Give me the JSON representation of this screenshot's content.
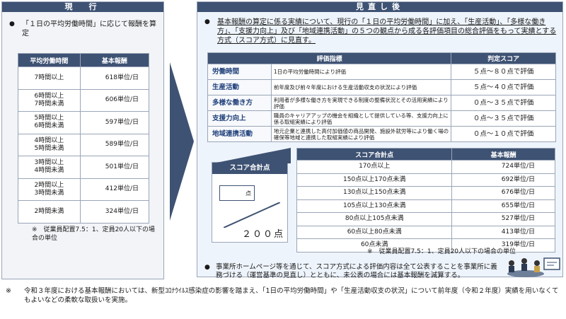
{
  "left": {
    "title": "現　行",
    "description": "「１日の平均労働時間」に応じて報酬を算定",
    "table": {
      "headers": [
        "平均労働時間",
        "基本報酬"
      ],
      "rows": [
        {
          "hours": "7時間以上",
          "fee": "618単位/日"
        },
        {
          "hours": "6時間以上\n7時間未満",
          "fee": "606単位/日"
        },
        {
          "hours": "5時間以上\n6時間未満",
          "fee": "597単位/日"
        },
        {
          "hours": "4時間以上\n5時間未満",
          "fee": "589単位/日"
        },
        {
          "hours": "3時間以上\n4時間未満",
          "fee": "501単位/日"
        },
        {
          "hours": "2時間以上\n3時間未満",
          "fee": "412単位/日"
        },
        {
          "hours": "2時間未満",
          "fee": "324単位/日"
        }
      ]
    },
    "note": "※　従業員配置7.5：1、定員20人以下の場合の単位"
  },
  "right": {
    "title": "見直し後",
    "description_main": "基本報酬の算定に係る実績について、現行の「１日の平均労働時間」に加え、「生産活動」、「多様な働き方」、「支援力向上」及び「地域連携活動」の５つの観点から成る各評価項目の総合評価をもって実績とする方式（スコア方式）に見直す。",
    "eval_table": {
      "headers": [
        "評価指標",
        "判定スコア"
      ],
      "rows": [
        {
          "name": "労働時間",
          "desc": "1日の平均労働時間により評価",
          "score": "５点～８０点で評価"
        },
        {
          "name": "生産活動",
          "desc": "前年度及び前々年度における生産活動収支の状況により評価",
          "score": "５点～４０点で評価"
        },
        {
          "name": "多様な働き方",
          "desc": "利用者が多様な働き方を実現できる制度の整備状況とその活用実績により評価",
          "score": "０点～３５点で評価"
        },
        {
          "name": "支援力向上",
          "desc": "職員のキャリアアップの機会を組織として提供している等、支援力向上に係る取組実績により評価",
          "score": "０点～３５点で評価"
        },
        {
          "name": "地域連携活動",
          "desc": "地元企業と連携した高付加価値の商品開発、施設外就労等により働く場の確保等地域と連携した取組実績により評価",
          "score": "０点～１０点で評価"
        }
      ]
    },
    "score_box": {
      "label": "スコア合計点",
      "unit": "点",
      "total": "２００点"
    },
    "score_table": {
      "headers": [
        "スコア合計点",
        "基本報酬"
      ],
      "rows": [
        {
          "range": "170点以上",
          "fee": "724単位/日"
        },
        {
          "range": "150点以上170点未満",
          "fee": "692単位/日"
        },
        {
          "range": "130点以上150点未満",
          "fee": "676単位/日"
        },
        {
          "range": "105点以上130点未満",
          "fee": "655単位/日"
        },
        {
          "range": "80点以上105点未満",
          "fee": "527単位/日"
        },
        {
          "range": "60点以上80点未満",
          "fee": "413単位/日"
        },
        {
          "range": "60点未満",
          "fee": "319単位/日"
        }
      ]
    },
    "note": "※　従業員配置7.5：1、定員20人以下の場合の単位",
    "bullet2": "事業所ホームページ等を通じて、スコア方式による評価内容は全て公表することを事業所に義務づける（運営基準の見直し）とともに、未公表の場合には基本報酬を減算する。"
  },
  "footer": {
    "mark": "※",
    "text": "令和３年度における基本報酬においては、新型ｺﾛﾅｳｲﾙｽ感染症の影響を踏まえ、「1日の平均労働時間」や「生産活動収支の状況」について前年度（令和２年度）実績を用いなくてもよいなどの柔軟な取扱いを実施。"
  },
  "colors": {
    "header": "#3e5273",
    "indicator": "#1f3f7a",
    "panel": "#eef4fb"
  }
}
